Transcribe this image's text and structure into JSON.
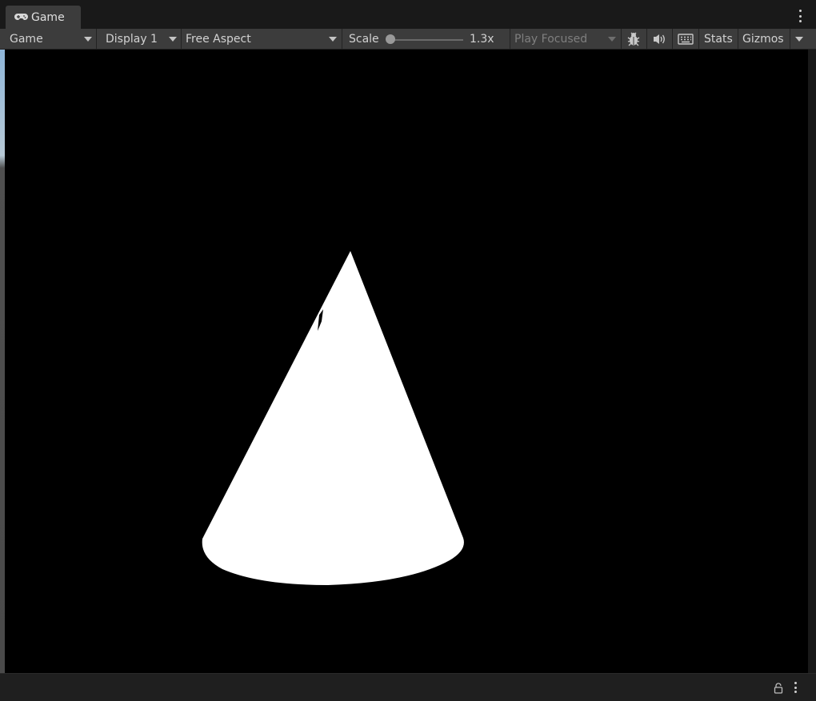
{
  "tab": {
    "title": "Game",
    "icon": "gamepad-icon"
  },
  "toolbar": {
    "view_mode": "Game",
    "display": "Display 1",
    "aspect": "Free Aspect",
    "scale_label": "Scale",
    "scale_value": "1.3x",
    "scale_fraction": 0.0,
    "play_mode": "Play Focused",
    "stats_label": "Stats",
    "gizmos_label": "Gizmos",
    "icons": [
      "bug-icon",
      "audio-icon",
      "keyboard-icon"
    ]
  },
  "viewport": {
    "background": "#000000",
    "object": "cone",
    "object_color": "#ffffff"
  },
  "statusbar": {
    "icons": [
      "lock-icon",
      "more-vert-icon"
    ]
  }
}
